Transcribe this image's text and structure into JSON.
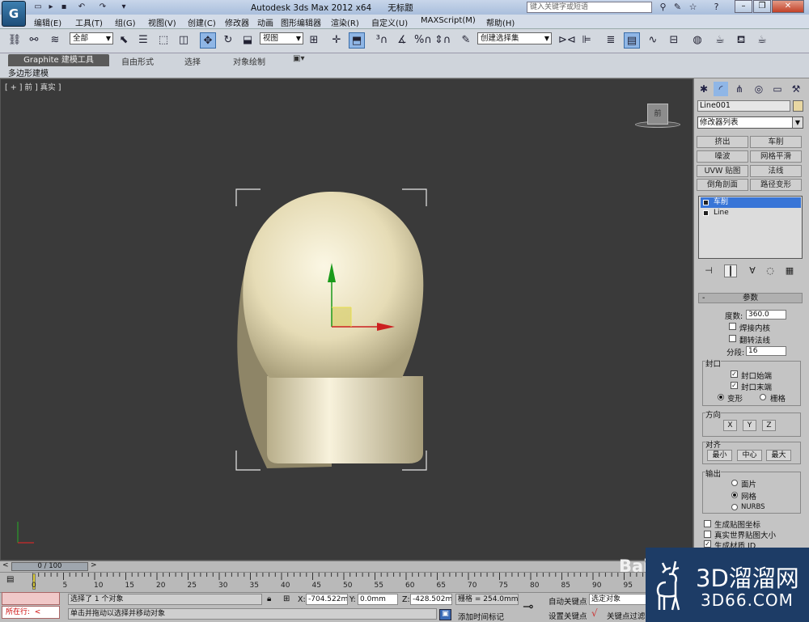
{
  "app": {
    "title": "Autodesk 3ds Max  2012 x64",
    "doc": "无标题",
    "logo": "G"
  },
  "search": {
    "placeholder": "键入关键字或短语"
  },
  "menu": [
    "编辑(E)",
    "工具(T)",
    "组(G)",
    "视图(V)",
    "创建(C)",
    "修改器",
    "动画",
    "图形编辑器",
    "渲染(R)",
    "自定义(U)",
    "MAXScript(M)",
    "帮助(H)"
  ],
  "toolbar": {
    "selection_filter": "全部",
    "ref_coord": "视图",
    "named_selection": "创建选择集"
  },
  "ribbon": {
    "tabs": [
      "Graphite 建模工具",
      "自由形式",
      "选择",
      "对象绘制"
    ],
    "sub": "多边形建模"
  },
  "viewport": {
    "label": "[ + ] 前 ] 真实 ]",
    "cube_face": "前"
  },
  "cmd": {
    "obj_name": "Line001",
    "mod_list": "修改器列表",
    "mod_buttons": [
      "挤出",
      "车削",
      "噪波",
      "网格平滑",
      "UVW 贴图",
      "法线",
      "倒角剖面",
      "路径变形"
    ],
    "stack": [
      "车削",
      "Line"
    ],
    "params": {
      "header": "参数",
      "degrees_label": "度数:",
      "degrees": "360.0",
      "weld_core": "焊接内核",
      "flip_normals": "翻转法线",
      "segments_label": "分段:",
      "segments": "16",
      "capping": "封口",
      "cap_start": "封口始端",
      "cap_end": "封口末端",
      "morph": "变形",
      "grid": "栅格",
      "direction": "方向",
      "dir_x": "X",
      "dir_y": "Y",
      "dir_z": "Z",
      "align": "对齐",
      "align_min": "最小",
      "align_center": "中心",
      "align_max": "最大",
      "output": "输出",
      "patch": "面片",
      "mesh": "网格",
      "nurbs": "NURBS",
      "gen_map_coords": "生成贴图坐标",
      "real_world": "真实世界贴图大小",
      "gen_mat_ids": "生成材质 ID"
    }
  },
  "timeline": {
    "frame": "0 / 100",
    "ticks": [
      "0",
      "5",
      "10",
      "15",
      "20",
      "25",
      "30",
      "35",
      "40",
      "45",
      "50",
      "55",
      "60",
      "65",
      "70",
      "75",
      "80",
      "85",
      "90",
      "95"
    ]
  },
  "status": {
    "selected": "选择了 1 个对象",
    "hint": "单击并拖动以选择并移动对象",
    "running": "所在行:",
    "x_label": "X:",
    "x": "-704.522m",
    "y_label": "Y:",
    "y": "0.0mm",
    "z_label": "Z:",
    "z": "-428.502m",
    "grid": "栅格 = 254.0mm",
    "auto_key": "自动关键点",
    "set_key": "设置关键点",
    "selected_obj": "选定对象",
    "add_time_tag": "添加时间标记",
    "key_filters": "关键点过滤器"
  },
  "watermark": {
    "line1": "3D溜溜网",
    "line2": "3D66.COM",
    "baidu": "Bai"
  },
  "colors": {
    "object": "#e8d7a2",
    "viewport_bg": "#3a3a3a",
    "selection_blue": "#3875d7"
  }
}
